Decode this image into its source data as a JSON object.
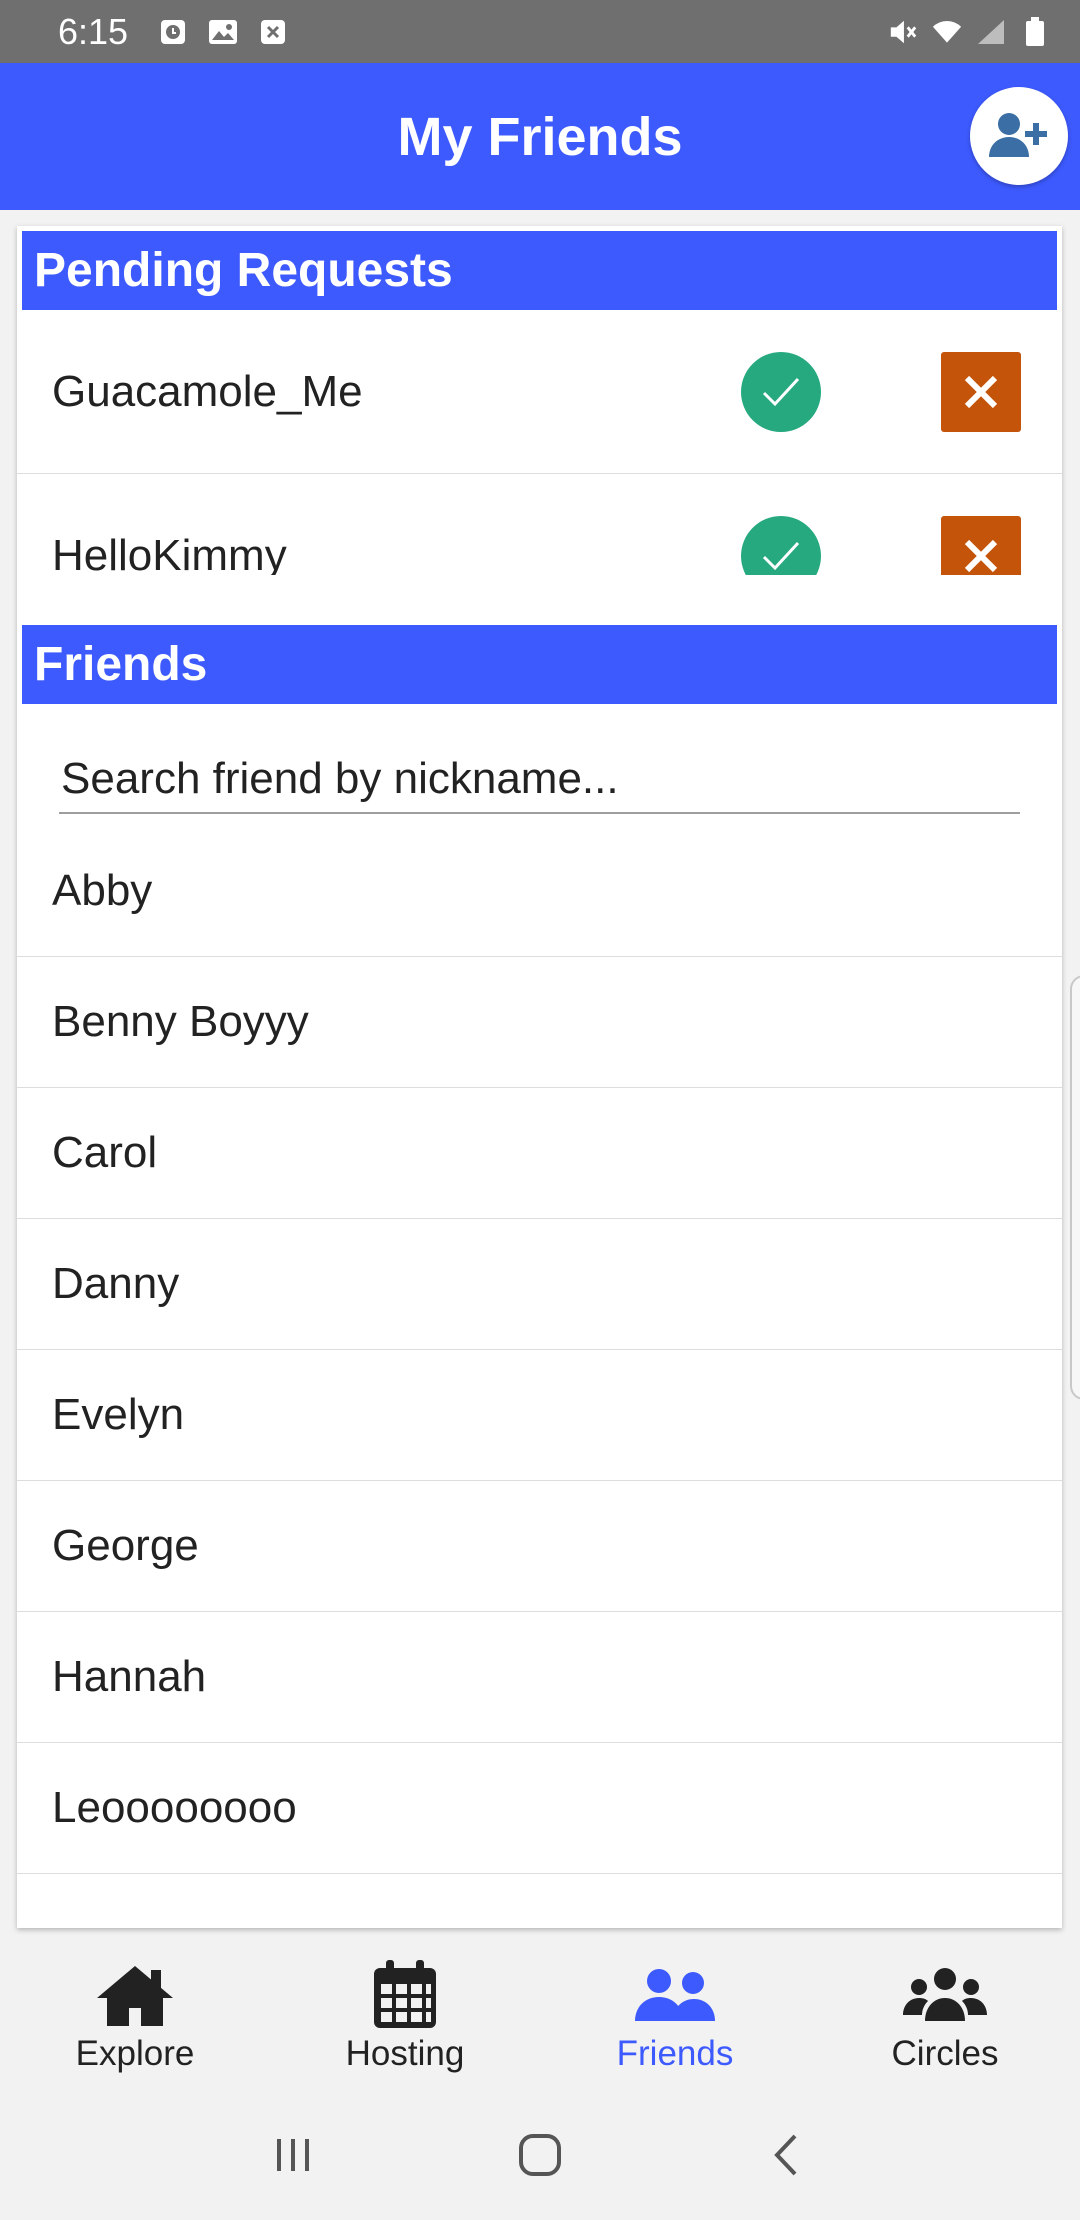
{
  "status_bar": {
    "time": "6:15",
    "left_icons": [
      "clock-notification-icon",
      "image-notification-icon",
      "close-notification-icon"
    ],
    "right_icons": [
      "mute-icon",
      "wifi-icon",
      "signal-icon",
      "battery-icon"
    ]
  },
  "header": {
    "title": "My Friends",
    "action_icon": "add-user-icon"
  },
  "pending": {
    "title": "Pending Requests",
    "items": [
      {
        "name": "Guacamole_Me"
      },
      {
        "name": "HelloKimmy"
      }
    ]
  },
  "friends": {
    "title": "Friends",
    "search_placeholder": "Search friend by nickname...",
    "items": [
      "Abby",
      "Benny Boyyy",
      "Carol",
      "Danny",
      "Evelyn",
      "George",
      "Hannah",
      "Leoooooooo"
    ]
  },
  "tabs": [
    {
      "label": "Explore",
      "icon": "home-icon",
      "active": false
    },
    {
      "label": "Hosting",
      "icon": "calendar-icon",
      "active": false
    },
    {
      "label": "Friends",
      "icon": "friends-icon",
      "active": true
    },
    {
      "label": "Circles",
      "icon": "circles-icon",
      "active": false
    }
  ],
  "colors": {
    "primary": "#3d5afe",
    "accept": "#26a97f",
    "decline": "#c4540a",
    "add_user_icon": "#3a6ea5"
  }
}
